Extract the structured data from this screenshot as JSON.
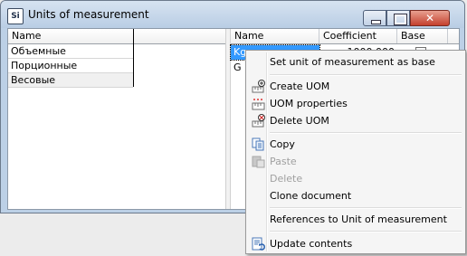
{
  "window": {
    "title": "Units of measurement",
    "app_icon_text": "Si",
    "close_glyph": "✕"
  },
  "left_table": {
    "column": "Name",
    "rows": [
      "Объемные",
      "Порционные",
      "Весовые"
    ],
    "selected_row": 2
  },
  "right_table": {
    "columns": {
      "name": "Name",
      "coefficient": "Coefficient",
      "base": "Base"
    },
    "rows": [
      {
        "name": "Kg",
        "coefficient": "1000.000",
        "base": true
      },
      {
        "name": "G",
        "coefficient": "",
        "base": false
      }
    ],
    "selected_row": 0
  },
  "context_menu": {
    "items": [
      {
        "label": "Set unit of measurement as base",
        "icon": "",
        "disabled": false
      },
      {
        "label": "Create UOM",
        "icon": "create-uom-icon",
        "disabled": false
      },
      {
        "label": "UOM properties",
        "icon": "uom-properties-icon",
        "disabled": false
      },
      {
        "label": "Delete UOM",
        "icon": "delete-uom-icon",
        "disabled": false
      },
      {
        "label": "Copy",
        "icon": "copy-icon",
        "disabled": false
      },
      {
        "label": "Paste",
        "icon": "paste-icon",
        "disabled": true
      },
      {
        "label": "Delete",
        "icon": "",
        "disabled": true
      },
      {
        "label": "Clone document",
        "icon": "",
        "disabled": false
      },
      {
        "label": "References to Unit of measurement",
        "icon": "",
        "disabled": false
      },
      {
        "label": "Update contents",
        "icon": "update-contents-icon",
        "disabled": false
      }
    ]
  },
  "colors": {
    "selection": "#3399ff",
    "close_button": "#c4402e",
    "title_bar": "#bcd0e6"
  }
}
